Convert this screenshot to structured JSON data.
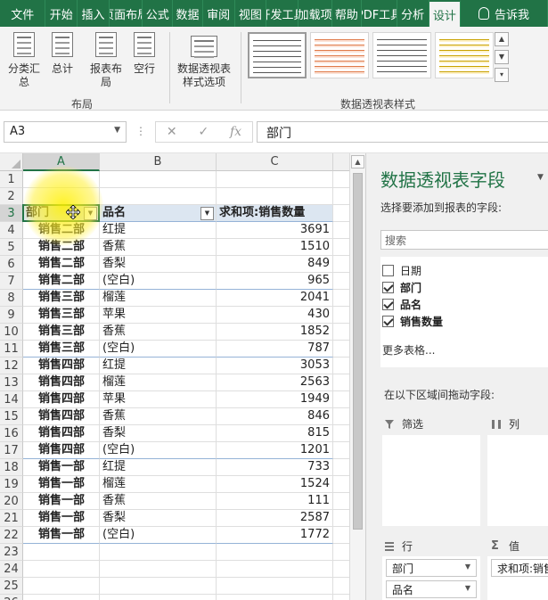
{
  "ribbon_tabs": [
    "文件",
    "开始",
    "插入",
    "页面布局",
    "公式",
    "数据",
    "审阅",
    "视图",
    "开发工具",
    "加载项",
    "帮助",
    "PDF工具",
    "分析",
    "设计",
    "告诉我"
  ],
  "active_tab": "设计",
  "ribbon": {
    "subtotals": "分类汇总",
    "grand_totals": "总计",
    "report_layout": "报表布局",
    "blank_rows": "空行",
    "layout_group": "布局",
    "style_options": "数据透视表样式选项",
    "styles_group": "数据透视表样式"
  },
  "formula_bar": {
    "name_box": "A3",
    "fx": "fx",
    "cancel": "✕",
    "confirm": "✓",
    "content": "部门"
  },
  "sheet": {
    "columns": [
      "A",
      "B",
      "C"
    ],
    "headers": {
      "dept": "部门",
      "product": "品名",
      "sum": "求和项:销售数量"
    },
    "rows": [
      {
        "r": 1,
        "type": "blank"
      },
      {
        "r": 2,
        "type": "blank"
      },
      {
        "r": 3,
        "type": "header"
      },
      {
        "r": 4,
        "dept": "销售二部",
        "product": "红提",
        "qty": "3691",
        "first": true
      },
      {
        "r": 5,
        "dept": "销售二部",
        "product": "香蕉",
        "qty": "1510"
      },
      {
        "r": 6,
        "dept": "销售二部",
        "product": "香梨",
        "qty": "849"
      },
      {
        "r": 7,
        "dept": "销售二部",
        "product": "(空白)",
        "qty": "965",
        "last": true
      },
      {
        "r": 8,
        "dept": "销售三部",
        "product": "榴莲",
        "qty": "2041",
        "first": true
      },
      {
        "r": 9,
        "dept": "销售三部",
        "product": "苹果",
        "qty": "430"
      },
      {
        "r": 10,
        "dept": "销售三部",
        "product": "香蕉",
        "qty": "1852"
      },
      {
        "r": 11,
        "dept": "销售三部",
        "product": "(空白)",
        "qty": "787",
        "last": true
      },
      {
        "r": 12,
        "dept": "销售四部",
        "product": "红提",
        "qty": "3053",
        "first": true
      },
      {
        "r": 13,
        "dept": "销售四部",
        "product": "榴莲",
        "qty": "2563"
      },
      {
        "r": 14,
        "dept": "销售四部",
        "product": "苹果",
        "qty": "1949"
      },
      {
        "r": 15,
        "dept": "销售四部",
        "product": "香蕉",
        "qty": "846"
      },
      {
        "r": 16,
        "dept": "销售四部",
        "product": "香梨",
        "qty": "815"
      },
      {
        "r": 17,
        "dept": "销售四部",
        "product": "(空白)",
        "qty": "1201",
        "last": true
      },
      {
        "r": 18,
        "dept": "销售一部",
        "product": "红提",
        "qty": "733",
        "first": true
      },
      {
        "r": 19,
        "dept": "销售一部",
        "product": "榴莲",
        "qty": "1524"
      },
      {
        "r": 20,
        "dept": "销售一部",
        "product": "香蕉",
        "qty": "111"
      },
      {
        "r": 21,
        "dept": "销售一部",
        "product": "香梨",
        "qty": "2587"
      },
      {
        "r": 22,
        "dept": "销售一部",
        "product": "(空白)",
        "qty": "1772",
        "last": true
      },
      {
        "r": 23,
        "type": "blank"
      },
      {
        "r": 24,
        "type": "blank"
      },
      {
        "r": 25,
        "type": "blank"
      },
      {
        "r": 26,
        "type": "blank"
      }
    ]
  },
  "pane": {
    "title": "数据透视表字段",
    "subtitle": "选择要添加到报表的字段:",
    "search_placeholder": "搜索",
    "fields": [
      {
        "label": "日期",
        "checked": false
      },
      {
        "label": "部门",
        "checked": true
      },
      {
        "label": "品名",
        "checked": true
      },
      {
        "label": "销售数量",
        "checked": true
      }
    ],
    "more_tables": "更多表格...",
    "drag_label": "在以下区域间拖动字段:",
    "filter_area": "筛选",
    "column_area": "列",
    "row_area": "行",
    "value_area": "值",
    "row_fields": [
      "部门",
      "品名"
    ],
    "value_fields": [
      "求和项:销售数量"
    ]
  },
  "colors": {
    "excel_green": "#217346",
    "header_fill": "#dce6f1",
    "highlight": "#fff000"
  }
}
